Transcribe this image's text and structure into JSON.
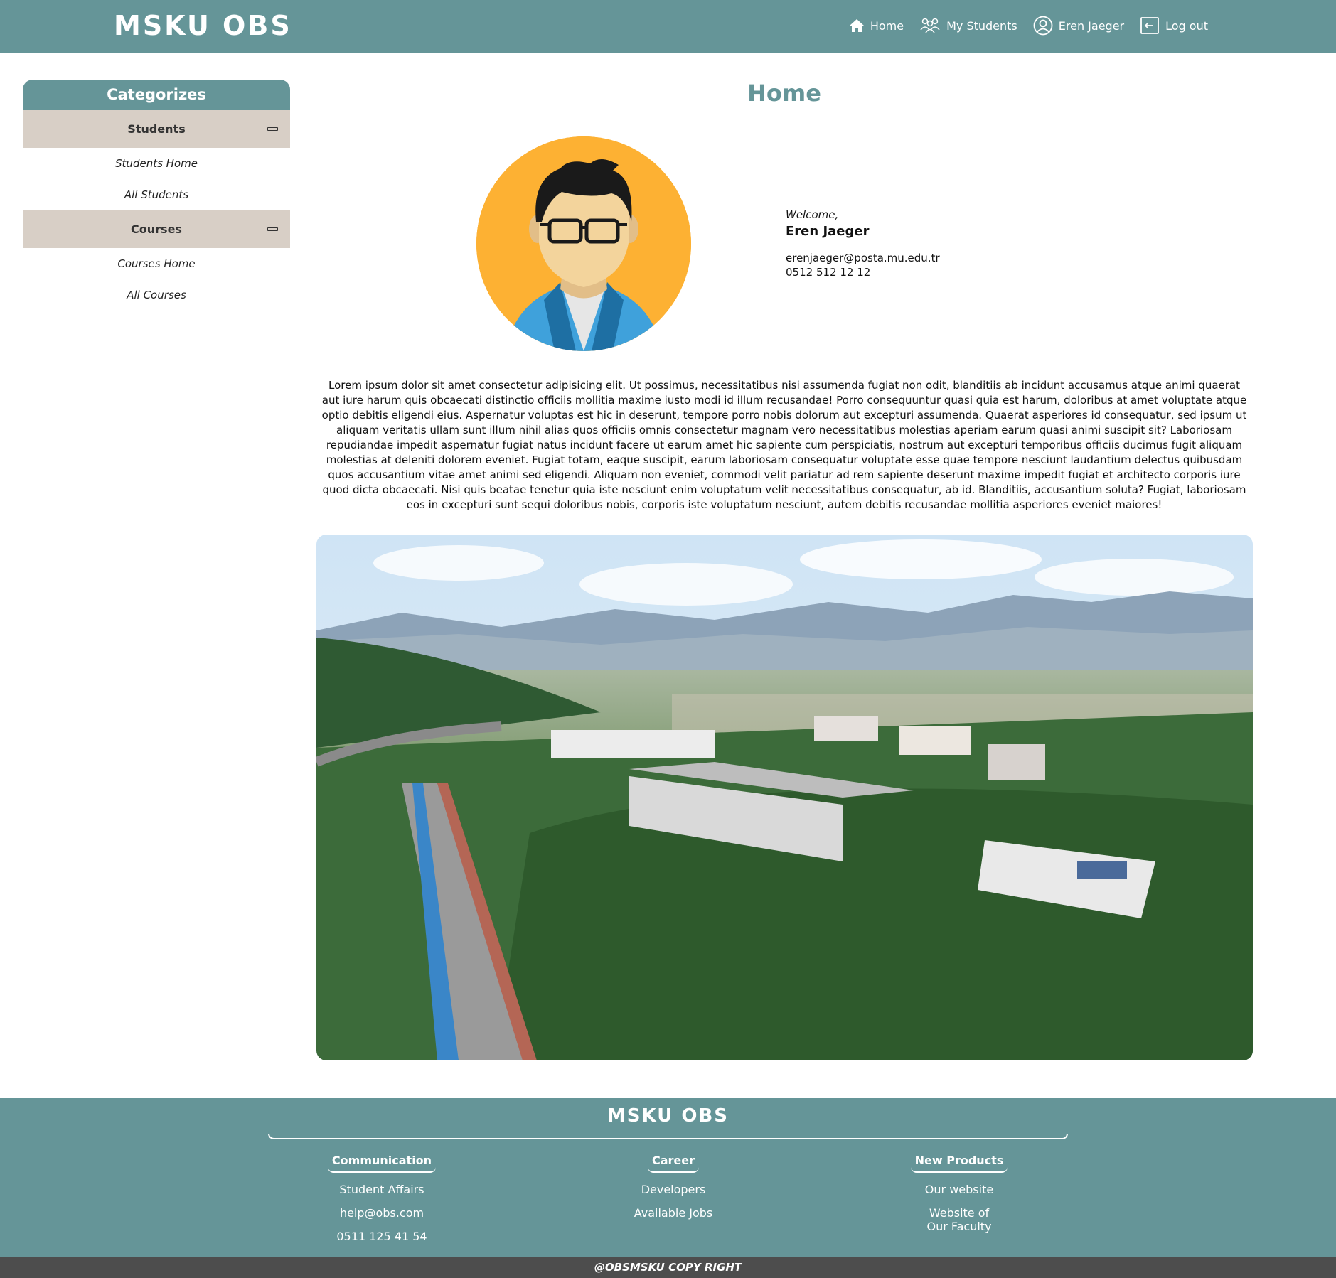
{
  "header": {
    "brand": "MSKU OBS",
    "nav": {
      "home": "Home",
      "my_students": "My Students",
      "user": "Eren Jaeger",
      "logout": "Log out"
    }
  },
  "sidebar": {
    "title": "Categorizes",
    "categories": [
      {
        "label": "Students",
        "links": [
          "Students Home",
          "All Students"
        ]
      },
      {
        "label": "Courses",
        "links": [
          "Courses Home",
          "All Courses"
        ]
      }
    ]
  },
  "main": {
    "title": "Home",
    "welcome": "Welcome,",
    "name": "Eren Jaeger",
    "email": "erenjaeger@posta.mu.edu.tr",
    "phone": "0512 512 12 12",
    "lorem": "Lorem ipsum dolor sit amet consectetur adipisicing elit. Ut possimus, necessitatibus nisi assumenda fugiat non odit, blanditiis ab incidunt accusamus atque animi quaerat aut iure harum quis obcaecati distinctio officiis mollitia maxime iusto modi id illum recusandae! Porro consequuntur quasi quia est harum, doloribus at amet voluptate atque optio debitis eligendi eius. Aspernatur voluptas est hic in deserunt, tempore porro nobis dolorum aut excepturi assumenda. Quaerat asperiores id consequatur, sed ipsum ut aliquam veritatis ullam sunt illum nihil alias quos officiis omnis consectetur magnam vero necessitatibus molestias aperiam earum quasi animi suscipit sit? Laboriosam repudiandae impedit aspernatur fugiat natus incidunt facere ut earum amet hic sapiente cum perspiciatis, nostrum aut excepturi temporibus officiis ducimus fugit aliquam molestias at deleniti dolorem eveniet. Fugiat totam, eaque suscipit, earum laboriosam consequatur voluptate esse quae tempore nesciunt laudantium delectus quibusdam quos accusantium vitae amet animi sed eligendi. Aliquam non eveniet, commodi velit pariatur ad rem sapiente deserunt maxime impedit fugiat et architecto corporis iure quod dicta obcaecati. Nisi quis beatae tenetur quia iste nesciunt enim voluptatum velit necessitatibus consequatur, ab id. Blanditiis, accusantium soluta? Fugiat, laboriosam eos in excepturi sunt sequi doloribus nobis, corporis iste voluptatum nesciunt, autem debitis recusandae mollitia asperiores eveniet maiores!"
  },
  "footer": {
    "brand": "MSKU OBS",
    "columns": [
      {
        "heading": "Communication",
        "links": [
          "Student Affairs",
          "help@obs.com",
          "0511 125 41 54"
        ]
      },
      {
        "heading": "Career",
        "links": [
          "Developers",
          "Available Jobs"
        ]
      },
      {
        "heading": "New Products",
        "links": [
          "Our website",
          "Website of Our Faculty"
        ]
      }
    ],
    "copyright": "@OBSMSKU COPY RIGHT"
  },
  "colors": {
    "primary": "#659598",
    "category_bg": "#d8cfc6",
    "copyright_bg": "#4d4d4d",
    "avatar_bg": "#fdb133"
  },
  "icons": {
    "home": "home-icon",
    "students": "users-icon",
    "user": "user-circle-icon",
    "logout": "logout-icon"
  }
}
